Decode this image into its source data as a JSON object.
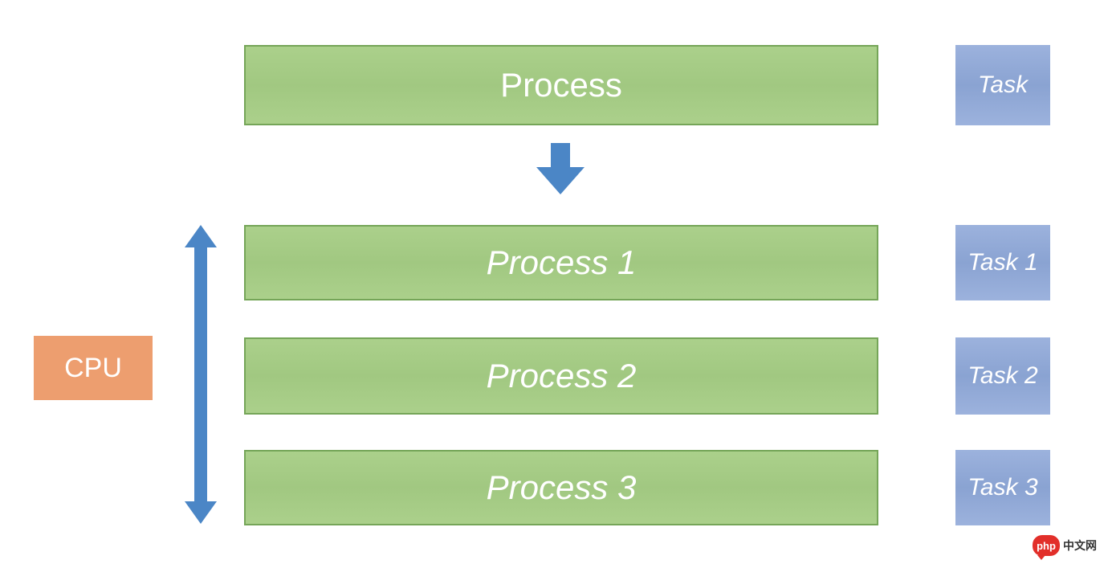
{
  "colors": {
    "process_fill_top": "#abd08b",
    "process_fill_mid": "#a1c881",
    "process_border": "#75a558",
    "task_fill_top": "#9cb2dd",
    "task_fill_mid": "#8aa3d2",
    "cpu_fill": "#ed9e6f",
    "arrow_fill": "#4b86c6",
    "text_white": "#ffffff"
  },
  "top_process": {
    "label": "Process"
  },
  "top_task": {
    "label": "Task"
  },
  "arrow_down": {
    "label": "down-arrow"
  },
  "cpu": {
    "label": "CPU"
  },
  "double_arrow": {
    "label": "vertical-double-arrow"
  },
  "processes": [
    {
      "label": "Process 1"
    },
    {
      "label": "Process 2"
    },
    {
      "label": "Process 3"
    }
  ],
  "tasks": [
    {
      "label": "Task 1"
    },
    {
      "label": "Task 2"
    },
    {
      "label": "Task 3"
    }
  ],
  "watermark": {
    "bubble": "php",
    "text": "中文网"
  }
}
